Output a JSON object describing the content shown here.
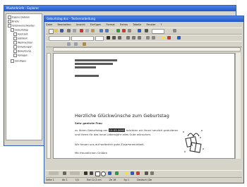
{
  "back_window": {
    "title": "Musterbriefe - Explorer",
    "tree_items": [
      "Eigene Dateien",
      "Briefe",
      "Glückwunschkarten",
      "Geburtstag",
      "Hochzeit",
      "Jubiläum",
      "Weihnachten",
      "Einladungen",
      "Bewerbung",
      "Vorlagen",
      "Sonstiges"
    ]
  },
  "front_window": {
    "title": "Geburtstag.doc - Textverarbeitung",
    "menu": [
      "Datei",
      "Bearbeiten",
      "Ansicht",
      "Einfügen",
      "Format",
      "Extras",
      "Tabelle",
      "Fenster",
      "?"
    ],
    "document": {
      "greeting": "Herzliche Glückwünsche zum Geburtstag",
      "subline": "Sehr geehrte Frau",
      "body_prefix": "zu Ihrem Geburtstag am",
      "highlight": "15.03.2003",
      "body_suffix": "möchten wir Ihnen herzlich gratulieren",
      "body_line2": "und Ihnen für das neue Lebensjahr alles Gute wünschen.",
      "closing_line": "Wir freuen uns auf weiterhin gute Zusammenarbeit.",
      "signature": "Mit freundlichen Grüßen"
    },
    "status": {
      "page": "Seite 1",
      "section": "Ab 1",
      "pages": "1/1",
      "position": "Bei 12,3 cm",
      "line": "Ze 18",
      "col": "Sp 1",
      "lang": "Deutsch (De"
    }
  },
  "colors": {
    "titlebar": "#1f54c8",
    "chrome": "#d6d3c8",
    "paper": "#ffffff",
    "accent_red": "#d23a2a",
    "accent_green": "#2f9a3a",
    "accent_blue": "#2a5bd0"
  }
}
